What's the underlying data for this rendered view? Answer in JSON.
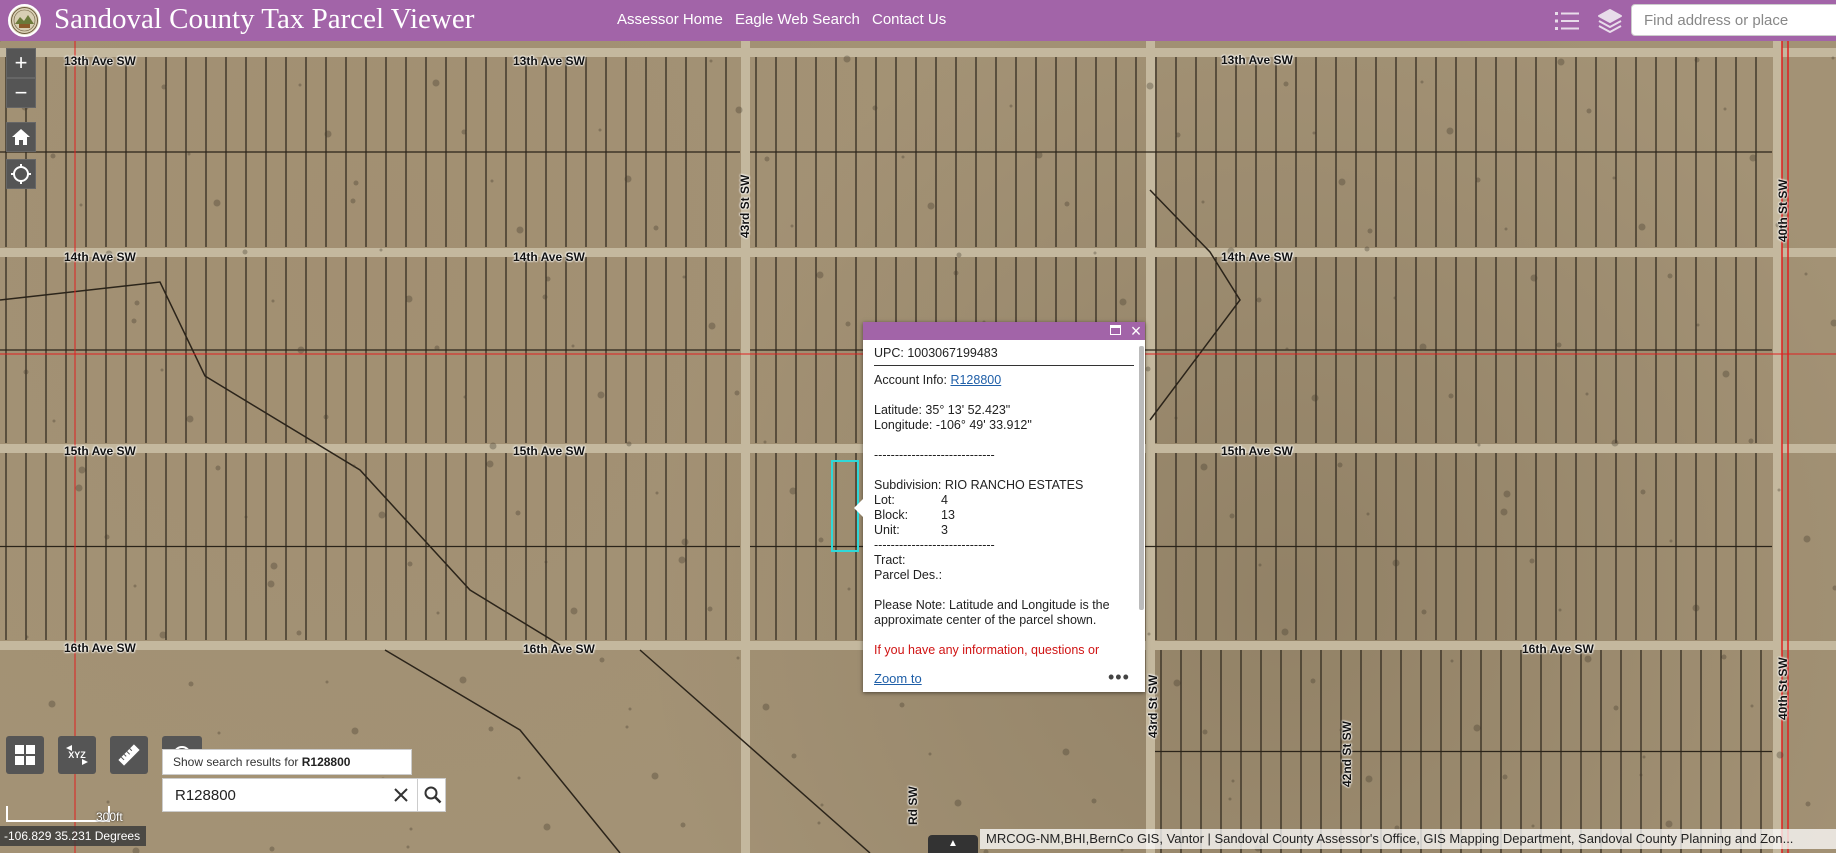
{
  "header": {
    "title": "Sandoval County Tax Parcel Viewer",
    "nav": [
      "Assessor Home",
      "Eagle Web Search",
      "Contact Us"
    ],
    "icons": [
      "legend-list-icon",
      "layers-icon"
    ],
    "search_placeholder": "Find address or place"
  },
  "map": {
    "street_labels": [
      "13th Ave SW",
      "13th Ave SW",
      "13th Ave SW",
      "14th Ave SW",
      "14th Ave SW",
      "14th Ave SW",
      "15th Ave SW",
      "15th Ave SW",
      "15th Ave SW",
      "16th Ave SW",
      "16th Ave SW",
      "16th Ave SW",
      "43rd St SW",
      "40th St SW",
      "40th St SW",
      "43rd St SW",
      "42nd St SW",
      "Rd SW"
    ],
    "controls": {
      "zoom_in": "+",
      "zoom_out": "−"
    },
    "tools": {
      "xyz_label": "XYZ"
    },
    "search_hint_prefix": "Show search results for",
    "search_hint_term": "R128800",
    "search_value": "R128800",
    "scale_label": "300ft",
    "coord_readout": "-106.829 35.231 Degrees",
    "attribution": "MRCOG-NM,BHI,BernCo GIS, Vantor | Sandoval County Assessor's Office, GIS Mapping Department, Sandoval County Planning and Zon...",
    "colors": {
      "header": "#a264a8",
      "highlight": "#2fd8d8",
      "boundary": "#e02020"
    }
  },
  "popup": {
    "upc": "UPC: 1003067199483",
    "account_label": "Account Info:",
    "account_link": "R128800",
    "latitude": "Latitude: 35° 13' 52.423\"",
    "longitude": "Longitude: -106° 49' 33.912\"",
    "separator": "-----------------------------",
    "subdivision": "Subdivision: RIO RANCHO ESTATES",
    "lot_label": "Lot:",
    "lot_value": "4",
    "block_label": "Block:",
    "block_value": "13",
    "unit_label": "Unit:",
    "unit_value": "3",
    "tract_label": "Tract:",
    "parcel_des_label": "Parcel Des.:",
    "note": "Please Note: Latitude and Longitude is the approximate center of the parcel shown.",
    "warning": "If you have any information, questions or",
    "zoom_to": "Zoom to",
    "more": "•••"
  }
}
